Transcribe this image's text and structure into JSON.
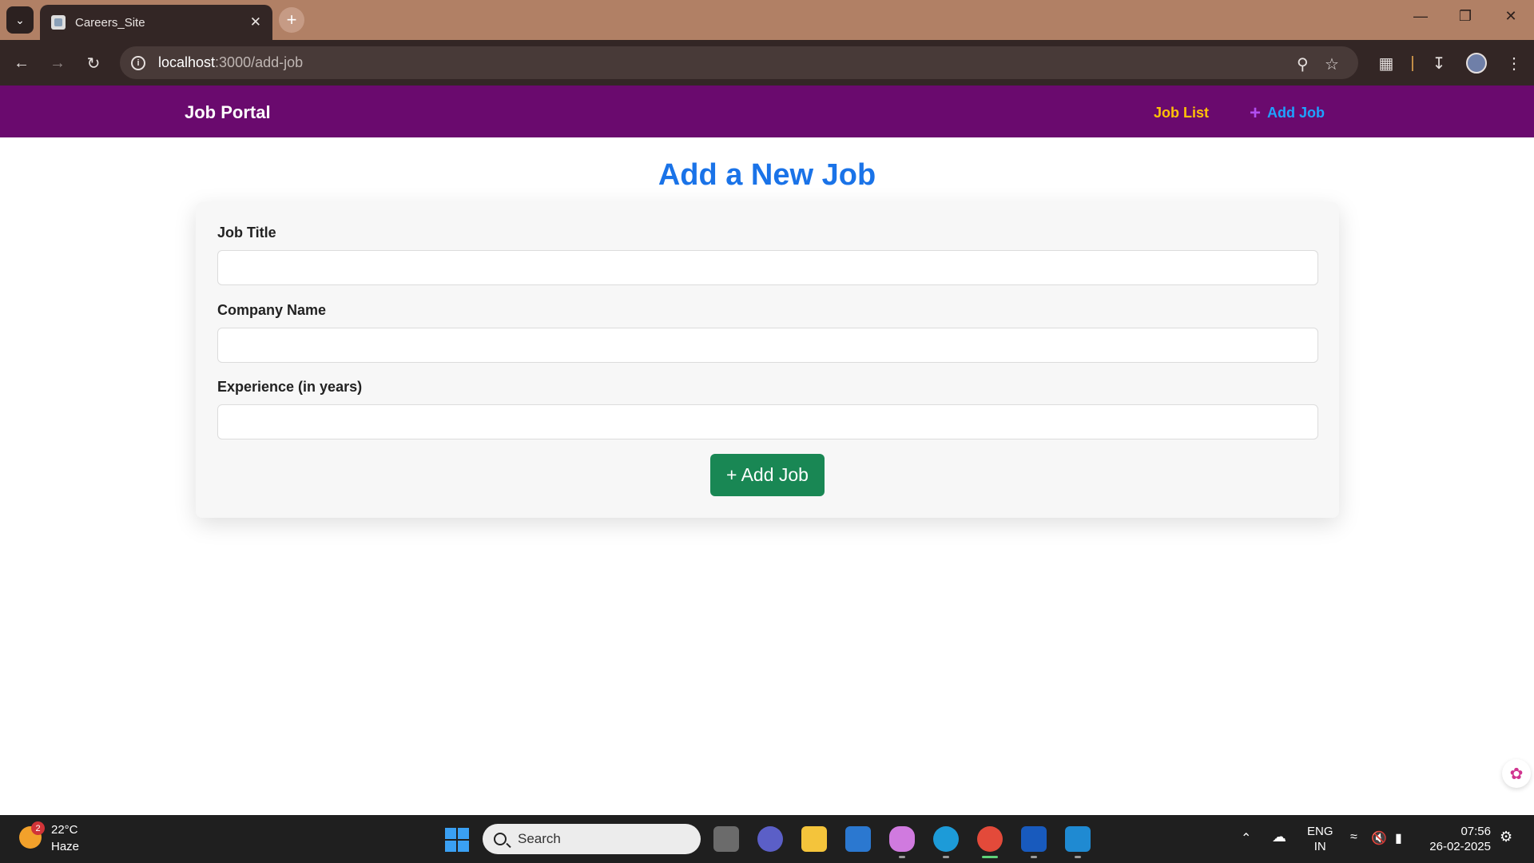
{
  "browser": {
    "tab_title": "Careers_Site",
    "url_host": "localhost",
    "url_rest": ":3000/add-job"
  },
  "navbar": {
    "brand": "Job Portal",
    "links": [
      {
        "label": "Job List",
        "color": "#ffc107"
      },
      {
        "label": "Add Job",
        "color": "#1ea3ff",
        "icon": "plus-icon"
      }
    ],
    "background": "#6a0a6e"
  },
  "page": {
    "title": "Add a New Job",
    "title_color": "#1a73e8"
  },
  "form": {
    "fields": [
      {
        "label": "Job Title",
        "value": "",
        "placeholder": ""
      },
      {
        "label": "Company Name",
        "value": "",
        "placeholder": ""
      },
      {
        "label": "Experience (in years)",
        "value": "",
        "placeholder": ""
      }
    ],
    "submit_label": "+ Add Job",
    "submit_color": "#198754"
  },
  "taskbar": {
    "weather_temp": "22°C",
    "weather_desc": "Haze",
    "weather_badge": "2",
    "search_placeholder": "Search",
    "lang_1": "ENG",
    "lang_2": "IN",
    "time": "07:56",
    "date": "26-02-2025"
  }
}
